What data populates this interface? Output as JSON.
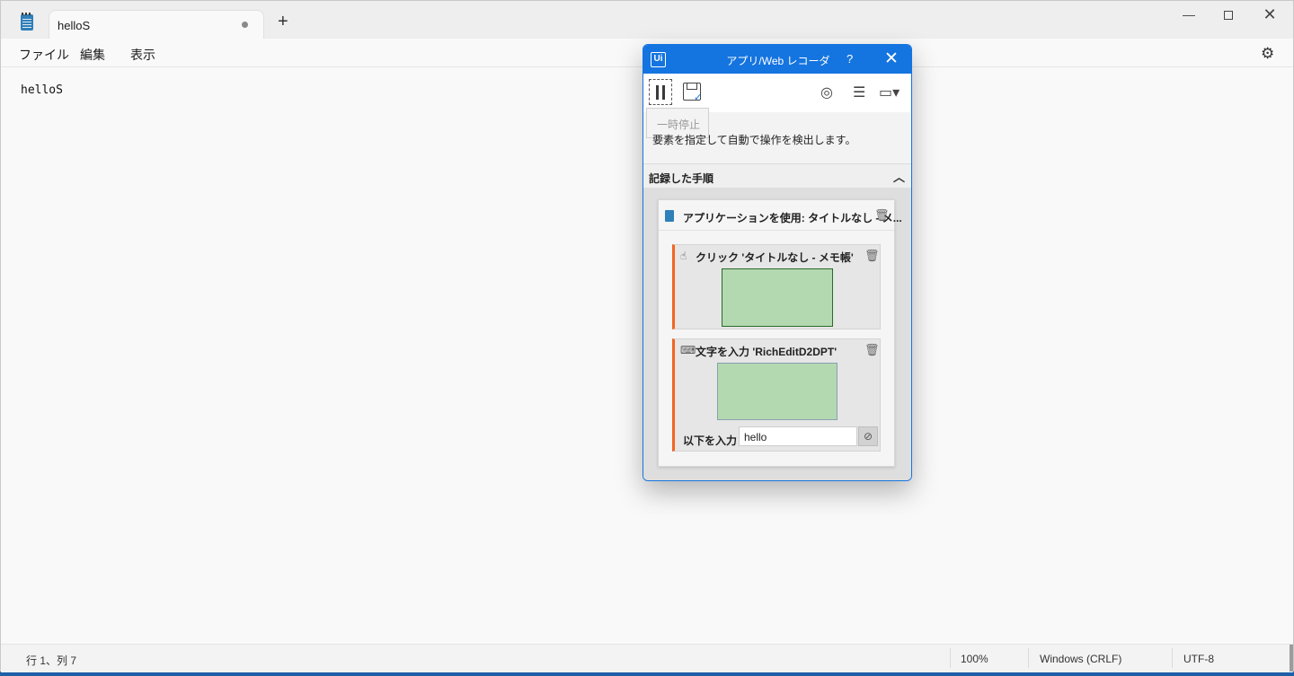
{
  "notepad": {
    "tab_title": "helloS",
    "new_tab": "+",
    "window_controls": {
      "minimize": "—",
      "close": "✕"
    },
    "menu": [
      "ファイル",
      "編集",
      "表示"
    ],
    "settings_icon": "gear-icon",
    "editor_text": "helloS",
    "status": {
      "position": "行 1、列 7",
      "zoom": "100%",
      "line_ending": "Windows (CRLF)",
      "encoding": "UTF-8"
    }
  },
  "recorder": {
    "title": "アプリ/Web レコーダー",
    "help": "?",
    "close": "✕",
    "logo": "Ui",
    "tooltip": "一時停止",
    "description": "要素を指定して自動で操作を検出します。",
    "section_title": "記録した手順",
    "app_step": "アプリケーションを使用: タイトルなし - メ...",
    "steps": [
      {
        "label": "クリック 'タイトルなし - メモ帳'",
        "icon": "click-icon"
      },
      {
        "label": "文字を入力 'RichEditD2DPT'",
        "icon": "type-into-icon",
        "input_label": "以下を入力",
        "input_value": "hello"
      }
    ],
    "colors": {
      "accent": "#1474e0",
      "step_marker": "#f26522",
      "screenshot": "#b3d9b0"
    }
  }
}
